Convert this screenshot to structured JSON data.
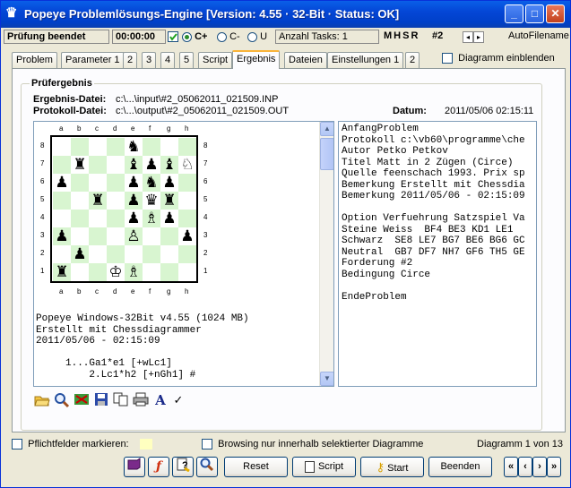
{
  "window": {
    "title": "Popeye Problemlösungs-Engine [Version: 4.55 · 32-Bit · Status: OK]",
    "icon": "queen-icon",
    "minimize": "_",
    "maximize": "□",
    "close": "✕"
  },
  "status": {
    "state": "Prüfung beendet",
    "time": "00:00:00",
    "cplus_label": "C+",
    "cminus_label": "C-",
    "u_label": "U",
    "tasks": "Anzahl Tasks: 1",
    "mhsr": "MHSR",
    "move_count": "#2",
    "auto_filename": "AutoFilename"
  },
  "tabs": [
    {
      "label": "Problem"
    },
    {
      "label": "Parameter 1"
    },
    {
      "label": "2"
    },
    {
      "label": "3"
    },
    {
      "label": "4"
    },
    {
      "label": "5"
    },
    {
      "label": "Script"
    },
    {
      "label": "Ergebnis",
      "active": true
    },
    {
      "label": "Dateien"
    },
    {
      "label": "Einstellungen 1"
    },
    {
      "label": "2"
    }
  ],
  "diagram_checkbox": "Diagramm einblenden",
  "result": {
    "group_label": "Prüfergebnis",
    "result_file_label": "Ergebnis-Datei:",
    "result_file": "c:\\...\\input\\#2_05062011_021509.INP",
    "protocol_file_label": "Protokoll-Datei:",
    "protocol_file": "c:\\...\\output\\#2_05062011_021509.OUT",
    "date_label": "Datum:",
    "date": "2011/05/06 02:15:11"
  },
  "board": {
    "files": [
      "a",
      "b",
      "c",
      "d",
      "e",
      "f",
      "g",
      "h"
    ],
    "ranks": [
      "8",
      "7",
      "6",
      "5",
      "4",
      "3",
      "2",
      "1"
    ],
    "pieces": [
      {
        "sq": "e8",
        "glyph": "♞"
      },
      {
        "sq": "b7",
        "glyph": "♜"
      },
      {
        "sq": "e7",
        "glyph": "♝"
      },
      {
        "sq": "f7",
        "glyph": "♟"
      },
      {
        "sq": "g7",
        "glyph": "♝"
      },
      {
        "sq": "h7",
        "glyph": "♘"
      },
      {
        "sq": "a6",
        "glyph": "♟"
      },
      {
        "sq": "e6",
        "glyph": "♟"
      },
      {
        "sq": "f6",
        "glyph": "♞"
      },
      {
        "sq": "g6",
        "glyph": "♟"
      },
      {
        "sq": "c5",
        "glyph": "♜"
      },
      {
        "sq": "e5",
        "glyph": "♟"
      },
      {
        "sq": "f5",
        "glyph": "♛"
      },
      {
        "sq": "g5",
        "glyph": "♜"
      },
      {
        "sq": "e4",
        "glyph": "♟"
      },
      {
        "sq": "f4",
        "glyph": "♗"
      },
      {
        "sq": "g4",
        "glyph": "♟"
      },
      {
        "sq": "a3",
        "glyph": "♟"
      },
      {
        "sq": "e3",
        "glyph": "♙"
      },
      {
        "sq": "h3",
        "glyph": "♟"
      },
      {
        "sq": "b2",
        "glyph": "♟"
      },
      {
        "sq": "a1",
        "glyph": "♜"
      },
      {
        "sq": "d1",
        "glyph": "♔"
      },
      {
        "sq": "e1",
        "glyph": "♗"
      }
    ]
  },
  "left_text": [
    "Popeye Windows-32Bit v4.55 (1024 MB)",
    "Erstellt mit Chessdiagrammer",
    "2011/05/06 - 02:15:09",
    "",
    "     1...Ga1*e1 [+wLc1]",
    "         2.Lc1*h2 [+nGh1] #"
  ],
  "right_text": [
    "AnfangProblem",
    "Protokoll c:\\vb60\\programme\\che",
    "Autor Petko Petkov",
    "Titel Matt in 2 Zügen (Circe)",
    "Quelle feenschach 1993. Prix sp",
    "Bemerkung Erstellt mit Chessdia",
    "Bemerkung 2011/05/06 - 02:15:09",
    "",
    "Option Verfuehrung Satzspiel Va",
    "Steine Weiss  BF4 BE3 KD1 LE1",
    "Schwarz  SE8 LE7 BG7 BE6 BG6 GC",
    "Neutral  GB7 DF7 NH7 GF6 TH5 GE",
    "Forderung #2",
    "Bedingung Circe",
    "",
    "EndeProblem"
  ],
  "toolbar": {
    "icons": [
      "open-folder-icon",
      "zoom-icon",
      "image-icon",
      "save-icon",
      "copy-icon",
      "print-icon",
      "font-icon",
      "check-icon"
    ],
    "font_label": "A",
    "check_label": "✓"
  },
  "footer": {
    "mandatory_label": "Pflichtfelder markieren:",
    "browsing_label": "Browsing nur innerhalb selektierter Diagramme",
    "diagram_counter": "Diagramm 1 von 13"
  },
  "buttons": {
    "reset": "Reset",
    "script": "Script",
    "start": "Start",
    "beenden": "Beenden",
    "nav_first": "«",
    "nav_prev": "‹",
    "nav_next": "›",
    "nav_last": "»"
  }
}
